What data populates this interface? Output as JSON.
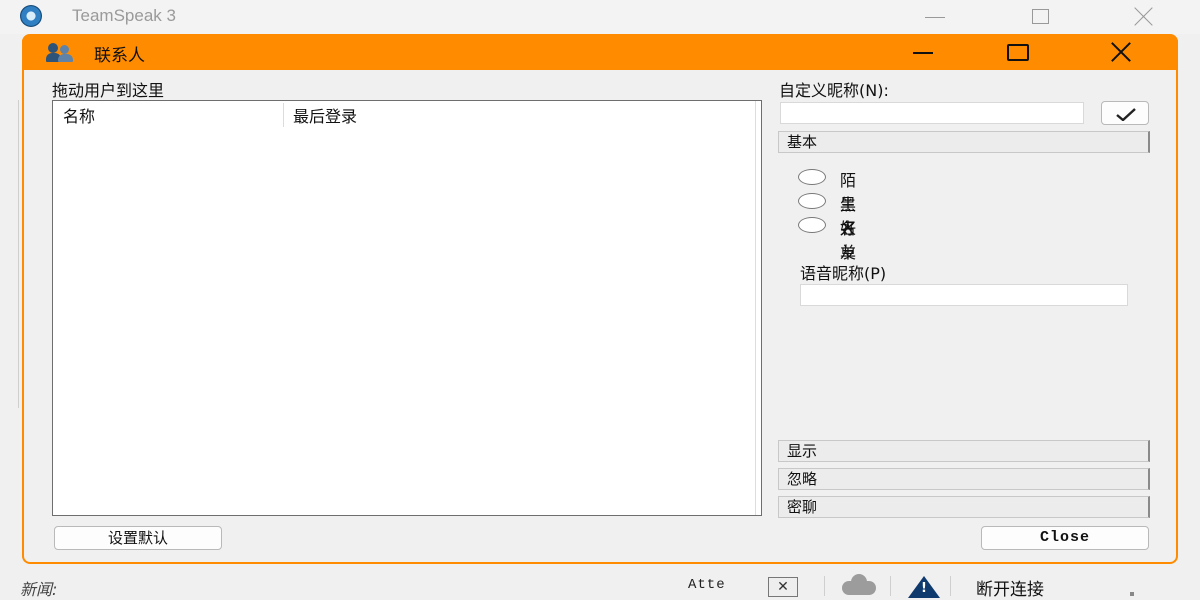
{
  "app": {
    "title": "TeamSpeak 3"
  },
  "statusbar": {
    "news_label": "新闻:",
    "atte_label": "Atte",
    "disconnect_label": "断开连接"
  },
  "dialog": {
    "title": "联系人",
    "drag_label": "拖动用户到这里",
    "columns": [
      "名称",
      "最后登录"
    ],
    "set_default_label": "设置默认",
    "close_label": "Close",
    "custom_nick_label": "自定义昵称(N):",
    "custom_nick_value": "",
    "sections": {
      "basic": "基本",
      "display": "显示",
      "ignore": "忽略",
      "whisper": "密聊"
    },
    "status_options": [
      "陌生人",
      "黑名单",
      "好友"
    ],
    "voice_nick_label": "语音昵称(P)",
    "voice_nick_value": ""
  },
  "colors": {
    "accent": "#ff8c00",
    "background": "#f0f0f0"
  }
}
